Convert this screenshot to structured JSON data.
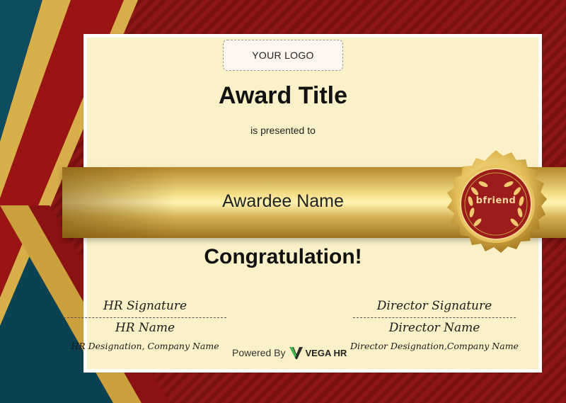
{
  "logo": {
    "text": "YOUR LOGO"
  },
  "award": {
    "title": "Award Title",
    "presented_to": "is presented to",
    "awardee": "Awardee Name",
    "congratulation": "Congratulation!"
  },
  "seal": {
    "brand": "bfriend"
  },
  "signatures": {
    "hr": {
      "label": "HR Signature",
      "name": "HR Name",
      "designation": "HR Designation, Company Name"
    },
    "director": {
      "label": "Director Signature",
      "name": "Director Name",
      "designation": "Director Designation,Company Name"
    }
  },
  "footer": {
    "powered_by": "Powered By",
    "brand": "VEGA HR"
  },
  "colors": {
    "border_red": "#8d1616",
    "teal": "#0d4a5c",
    "gold": "#d9b24a",
    "paper": "#fbf1c8",
    "seal_red": "#9c1c1c"
  }
}
